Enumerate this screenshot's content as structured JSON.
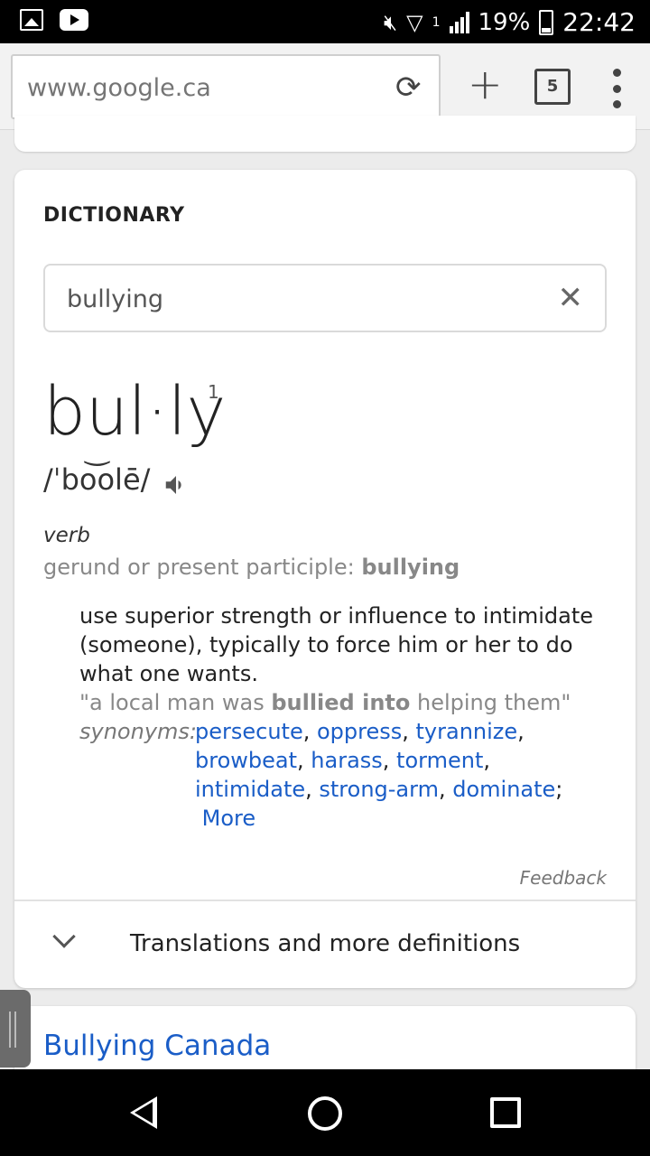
{
  "status_bar": {
    "battery": "19%",
    "time": "22:42",
    "network_slot": "1",
    "icons": [
      "gallery-icon",
      "youtube-icon",
      "mute-icon",
      "wifi-icon",
      "signal-icon",
      "battery-icon"
    ]
  },
  "browser": {
    "url": "www.google.ca",
    "tab_count": "5",
    "icons": [
      "reload-icon",
      "new-tab-icon",
      "tab-switcher-icon",
      "overflow-menu-icon"
    ]
  },
  "dictionary": {
    "heading": "DICTIONARY",
    "search_value": "bullying",
    "word": "bul·ly",
    "superscript": "1",
    "pronunciation": "/ˈbo͝olē/",
    "part_of_speech": "verb",
    "gerund_label": "gerund or present participle: ",
    "gerund_value": "bullying",
    "definition": "use superior strength or influence to intimidate (someone), typically to force him or her to do what one wants.",
    "example_pre": "\"a local man was ",
    "example_bold": "bullied into",
    "example_post": " helping them\"",
    "synonyms_label": "synonyms:",
    "synonyms": [
      "persecute",
      "oppress",
      "tyrannize",
      "browbeat",
      "harass",
      "torment",
      "intimidate",
      "strong-arm",
      "dominate"
    ],
    "more_link": "More",
    "feedback": "Feedback",
    "more_definitions": "Translations and more definitions"
  },
  "next_result": {
    "title": "Bullying Canada"
  },
  "colors": {
    "link": "#1a5dc7",
    "muted": "#888888"
  }
}
